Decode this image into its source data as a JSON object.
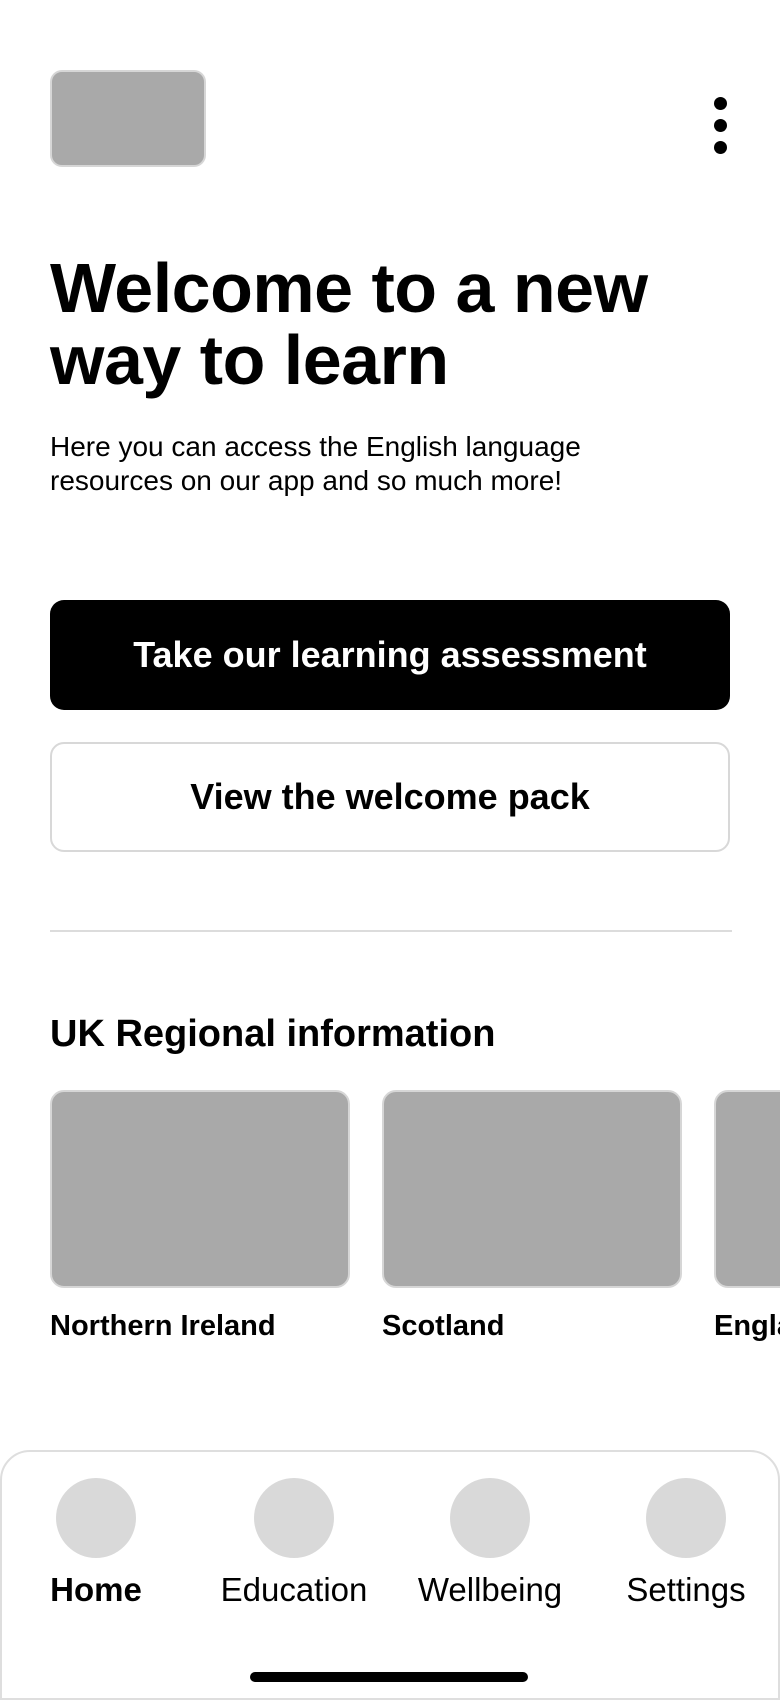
{
  "header": {
    "logo_icon": "logo-placeholder",
    "menu_icon": "kebab-menu-icon"
  },
  "hero": {
    "title": "Welcome to a new way to learn",
    "subtitle": "Here you can access the English language resources on our app and so much more!"
  },
  "actions": {
    "primary_label": "Take our learning assessment",
    "secondary_label": "View the welcome pack"
  },
  "regional": {
    "title": "UK Regional information",
    "cards": [
      {
        "label": "Northern Ireland"
      },
      {
        "label": "Scotland"
      },
      {
        "label": "England"
      }
    ]
  },
  "tabbar": {
    "items": [
      {
        "label": "Home",
        "icon": "home-icon",
        "active": true
      },
      {
        "label": "Education",
        "icon": "education-icon",
        "active": false
      },
      {
        "label": "Wellbeing",
        "icon": "wellbeing-icon",
        "active": false
      },
      {
        "label": "Settings",
        "icon": "settings-icon",
        "active": false
      }
    ]
  },
  "colors": {
    "primary": "#000000",
    "placeholder": "#a9a9a9",
    "icon_placeholder": "#d9d9d9",
    "border": "#d8d8d8"
  }
}
